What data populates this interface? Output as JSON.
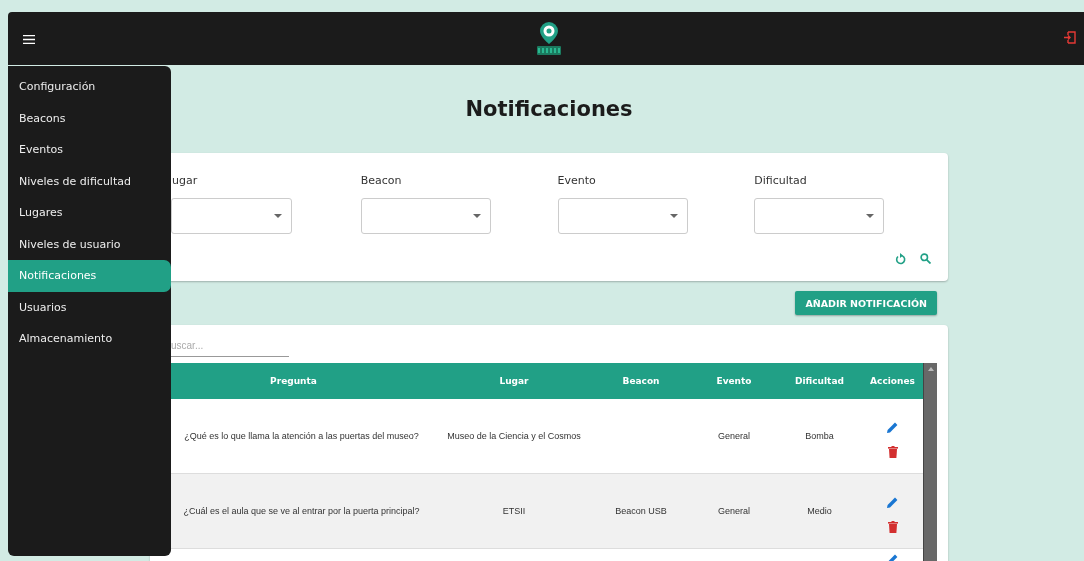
{
  "drawer": {
    "items": [
      {
        "label": "Configuración",
        "selected": false
      },
      {
        "label": "Beacons",
        "selected": false
      },
      {
        "label": "Eventos",
        "selected": false
      },
      {
        "label": "Niveles de dificultad",
        "selected": false
      },
      {
        "label": "Lugares",
        "selected": false
      },
      {
        "label": "Niveles de usuario",
        "selected": false
      },
      {
        "label": "Notificaciones",
        "selected": true
      },
      {
        "label": "Usuarios",
        "selected": false
      },
      {
        "label": "Almacenamiento",
        "selected": false
      }
    ]
  },
  "title": "Notificaciones",
  "filters": [
    {
      "label": "ugar"
    },
    {
      "label": "Beacon"
    },
    {
      "label": "Evento"
    },
    {
      "label": "Dificultad"
    }
  ],
  "add_button": "AÑADIR NOTIFICACIÓN",
  "search": {
    "placeholder": "uscar..."
  },
  "table": {
    "columns": [
      "Pregunta",
      "Lugar",
      "Beacon",
      "Evento",
      "Dificultad",
      "Acciones"
    ],
    "rows": [
      {
        "question": "¿Qué es lo que llama la atención a las puertas del museo?",
        "place": "Museo de la Ciencia y el Cosmos",
        "event": "General",
        "difficulty": "Bomba"
      },
      {
        "question": "¿Cuál es el aula que se ve al entrar por la puerta principal?",
        "place": "ETSII",
        "beacon": "Beacon USB",
        "event": "General",
        "difficulty": "Medio"
      },
      {}
    ]
  }
}
